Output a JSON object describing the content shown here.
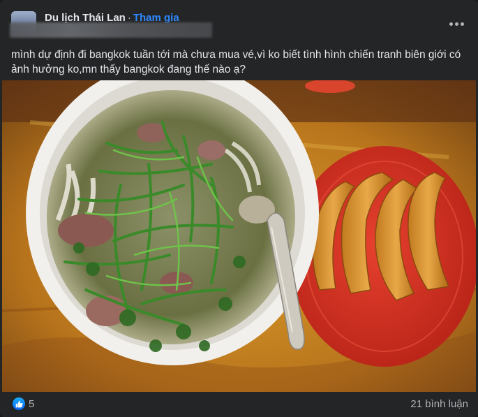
{
  "post": {
    "group_name": "Du lịch Thái Lan",
    "separator": "·",
    "join_label": "Tham gia",
    "text": "mình dự định đi bangkok tuần tới mà chưa mua vé,vì ko biết tình hình chiến tranh biên giới có ảnh hưởng ko,mn thấy bangkok đang thế nào ạ?"
  },
  "photo": {
    "icon": "photo-pho-bowl-and-fried-dough"
  },
  "footer": {
    "like_count": "5",
    "comments_label": "21 bình luận"
  },
  "colors": {
    "background": "#242526",
    "text": "#e4e6eb",
    "secondary": "#b0b3b8",
    "accent": "#2d88ff"
  }
}
